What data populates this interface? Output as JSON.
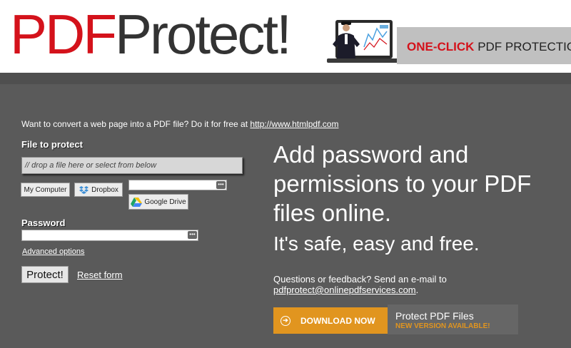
{
  "header": {
    "logo_part1": "PDF",
    "logo_part2": "Protect!",
    "tagline_accent": "ONE-CLICK",
    "tagline_rest": "PDF PROTECTION"
  },
  "promo": {
    "text": "Want to convert a web page into a PDF file? Do it for free at",
    "link": "http://www.htmlpdf.com"
  },
  "form": {
    "file_label": "File to protect",
    "drop_placeholder": "// drop a file here or select from below",
    "my_computer": "My Computer",
    "dropbox": "Dropbox",
    "google_drive": "Google Drive",
    "url_value": "",
    "password_label": "Password",
    "password_value": "",
    "advanced_options": "Advanced options",
    "protect_button": "Protect!",
    "reset_form": "Reset form"
  },
  "hero": {
    "headline": "Add password and permissions to your PDF files online.",
    "subheadline": "It's safe, easy and free.",
    "feedback_text": "Questions or feedback? Send an e-mail to",
    "feedback_email": "pdfprotect@onlinepdfservices.com",
    "feedback_period": "."
  },
  "download": {
    "button": "DOWNLOAD NOW",
    "title": "Protect PDF Files",
    "badge": "NEW VERSION AVAILABLE!"
  },
  "colors": {
    "brand_red": "#d4121b",
    "accent_orange": "#e1951f",
    "background": "#555555"
  },
  "icons": {
    "dropbox": "dropbox-icon",
    "google_drive": "google-drive-icon",
    "download": "download-arrow-icon",
    "field_menu": "dots-icon"
  }
}
